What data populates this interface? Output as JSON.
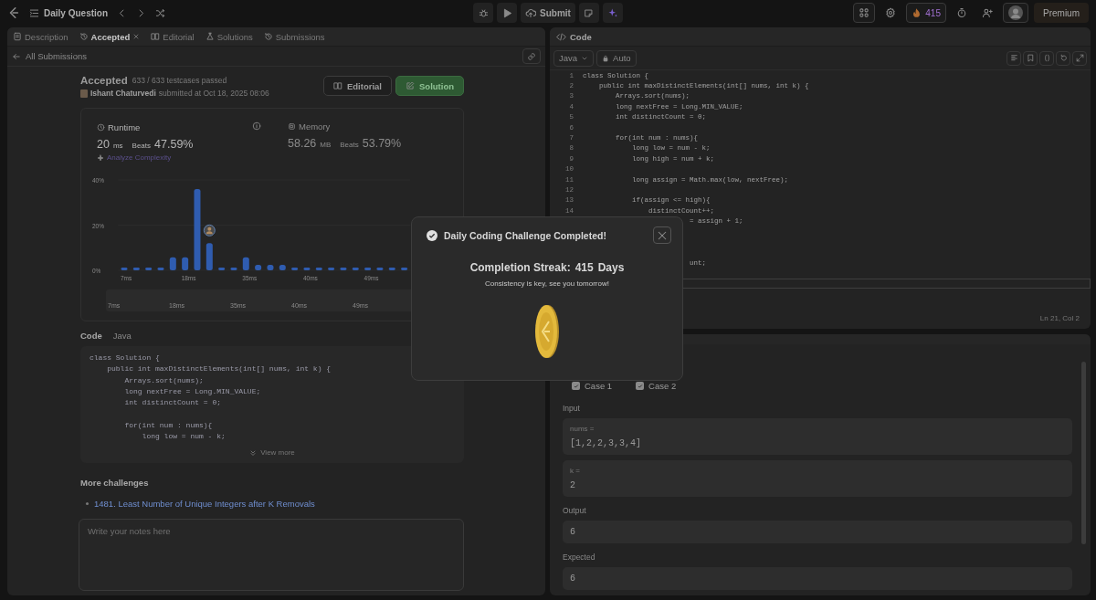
{
  "topbar": {
    "title": "Daily Question",
    "submit": "Submit",
    "streak": "415",
    "premium": "Premium"
  },
  "left_tabs": [
    {
      "label": "Description",
      "selected": false,
      "closable": false
    },
    {
      "label": "Accepted",
      "selected": true,
      "closable": true
    },
    {
      "label": "Editorial",
      "selected": false,
      "closable": false
    },
    {
      "label": "Solutions",
      "selected": false,
      "closable": false
    },
    {
      "label": "Submissions",
      "selected": false,
      "closable": false
    }
  ],
  "back_link": "All Submissions",
  "submission": {
    "status": "Accepted",
    "testcases": "633 / 633 testcases passed",
    "author": "Ishant Chaturvedi",
    "submitted": "submitted at Oct 18, 2025 08:06",
    "buttons": [
      {
        "label": "Editorial",
        "kind": "outline"
      },
      {
        "label": "Solution",
        "kind": "primary"
      }
    ]
  },
  "runtime": {
    "label": "Runtime",
    "value": "20",
    "unit": "ms",
    "beats_label": "Beats",
    "beats": "47.59%",
    "analyze": "Analyze Complexity",
    "selected": true
  },
  "memory": {
    "label": "Memory",
    "value": "58.26",
    "unit": "MB",
    "beats_label": "Beats",
    "beats": "53.79%",
    "selected": false
  },
  "chart_data": {
    "type": "bar",
    "ylim": [
      0,
      40
    ],
    "yticks": [
      {
        "value": 0,
        "label": "0%"
      },
      {
        "value": 20,
        "label": "20%"
      },
      {
        "value": 40,
        "label": "40%"
      }
    ],
    "values": [
      1.2,
      1.2,
      1.2,
      1.2,
      5.8,
      5.8,
      36,
      12,
      1.2,
      1.2,
      5.8,
      2.4,
      2.4,
      2.4,
      1.2,
      1.2,
      1.2,
      1.2,
      1.2,
      1.2,
      1.2,
      1.2,
      1.2,
      1.2
    ]
  },
  "chart_axis_labels": [
    "7ms",
    "18ms",
    "35ms",
    "40ms",
    "49ms"
  ],
  "navigator_labels": [
    "7ms",
    "18ms",
    "35ms",
    "40ms",
    "49ms"
  ],
  "code_preview": {
    "title": "Code",
    "language": "Java",
    "more": "View more",
    "lines": [
      {
        "kind": "code",
        "text": "class Solution {"
      },
      {
        "kind": "code",
        "text": "    public int maxDistinctElements(int[] nums, int k) {"
      },
      {
        "kind": "code",
        "text": "        Arrays.sort(nums);"
      },
      {
        "kind": "code",
        "text": "        long nextFree = Long.MIN_VALUE;"
      },
      {
        "kind": "code",
        "text": "        int distinctCount = 0;"
      },
      {
        "kind": "blank"
      },
      {
        "kind": "code",
        "text": "        for(int num : nums){"
      },
      {
        "kind": "code",
        "text": "            long low = num - k;"
      }
    ]
  },
  "more_challenges": {
    "title": "More challenges",
    "items": [
      "1481. Least Number of Unique Integers after K Removals"
    ]
  },
  "notes": {
    "placeholder": "Write your notes here"
  },
  "editor": {
    "title": "Code",
    "language": "Java",
    "mode": "Auto",
    "cursor": "Ln 21, Col 2",
    "lines": [
      {
        "kind": "code",
        "number": "1",
        "text": "class Solution {",
        "current": false
      },
      {
        "kind": "code",
        "number": "2",
        "text": "    public int maxDistinctElements(int[] nums, int k) {",
        "current": false
      },
      {
        "kind": "code",
        "number": "3",
        "text": "        Arrays.sort(nums);",
        "current": false
      },
      {
        "kind": "code",
        "number": "4",
        "text": "        long nextFree = Long.MIN_VALUE;",
        "current": false
      },
      {
        "kind": "code",
        "number": "5",
        "text": "        int distinctCount = 0;",
        "current": false
      },
      {
        "kind": "blank",
        "number": "6",
        "current": false
      },
      {
        "kind": "code",
        "number": "7",
        "text": "        for(int num : nums){",
        "current": false
      },
      {
        "kind": "code",
        "number": "8",
        "text": "            long low = num - k;",
        "current": false
      },
      {
        "kind": "code",
        "number": "9",
        "text": "            long high = num + k;",
        "current": false
      },
      {
        "kind": "blank",
        "number": "10",
        "current": false
      },
      {
        "kind": "code",
        "number": "11",
        "text": "            long assign = Math.max(low, nextFree);",
        "current": false
      },
      {
        "kind": "blank",
        "number": "12",
        "current": false
      },
      {
        "kind": "code",
        "number": "13",
        "text": "            if(assign <= high){",
        "current": false
      },
      {
        "kind": "code",
        "number": "14",
        "text": "                distinctCount++;",
        "current": false
      },
      {
        "kind": "code",
        "text": "                          = assign + 1;",
        "current": false
      },
      {
        "kind": "blank",
        "current": false
      },
      {
        "kind": "blank",
        "current": false
      },
      {
        "kind": "blank",
        "current": false
      },
      {
        "kind": "code",
        "text": "                          unt;",
        "current": false
      },
      {
        "kind": "blank",
        "current": false
      },
      {
        "kind": "blank",
        "current": true
      }
    ]
  },
  "testcases": {
    "cases": [
      {
        "label": "Case 1",
        "passed": true
      },
      {
        "label": "Case 2",
        "passed": true
      }
    ],
    "input_label": "Input",
    "inputs": [
      {
        "name": "nums =",
        "value": "[1,2,2,3,3,4]"
      },
      {
        "name": "k =",
        "value": "2"
      }
    ],
    "output_label": "Output",
    "output": "6",
    "expected_label": "Expected",
    "expected": "6"
  },
  "modal": {
    "title": "Daily Coding Challenge Completed!",
    "streak_label": "Completion Streak:",
    "streak": "415",
    "streak_unit": "Days",
    "message": "Consistency is key, see you tomorrow!"
  }
}
